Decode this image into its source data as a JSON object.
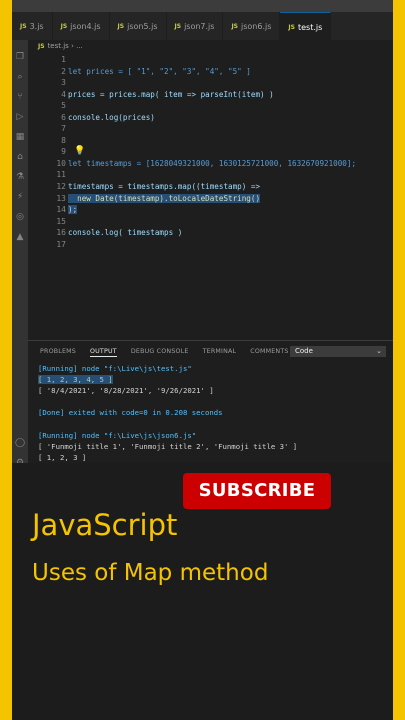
{
  "tabs": [
    {
      "name": "3.js",
      "active": false
    },
    {
      "name": "json4.js",
      "active": false
    },
    {
      "name": "json5.js",
      "active": false
    },
    {
      "name": "json7.js",
      "active": false
    },
    {
      "name": "json6.js",
      "active": false
    },
    {
      "name": "test.js",
      "active": true
    }
  ],
  "tab_icon": "JS",
  "breadcrumb": {
    "file": "test.js",
    "sep": "›",
    "more": "..."
  },
  "editor": {
    "line_numbers": [
      "1",
      "2",
      "3",
      "4",
      "5",
      "6",
      "7",
      "8",
      "9",
      "10",
      "11",
      "12",
      "13",
      "14",
      "15",
      "16",
      "17"
    ],
    "lines": {
      "l2": "let prices = [ \"1\", \"2\", \"3\", \"4\", \"5\" ]",
      "l4": "prices = prices.map( item => parseInt(item) )",
      "l6": "console.log(prices)",
      "l10": "let timestamps = [1628049321000, 1630125721000, 1632670921000];",
      "l12": "timestamps = timestamps.map((timestamp) =>",
      "l13": "  new Date(timestamp).toLocaleDateString()",
      "l14": ");",
      "l16": "console.log( timestamps )"
    }
  },
  "panel": {
    "tabs": [
      "PROBLEMS",
      "OUTPUT",
      "DEBUG CONSOLE",
      "TERMINAL",
      "COMMENTS"
    ],
    "active_tab": "OUTPUT",
    "dropdown_value": "Code",
    "output": {
      "o1": "[Running] node \"f:\\Live\\js\\test.js\"",
      "o2": "[ 1, 2, 3, 4, 5 ]",
      "o3": "[ '8/4/2021', '8/28/2021', '9/26/2021' ]",
      "o5": "[Done] exited with code=0 in 0.208 seconds",
      "o7": "[Running] node \"f:\\Live\\js\\json6.js\"",
      "o8": "[ 'Funmoji title 1', 'Funmoji title 2', 'Funmoji title 3' ]",
      "o9": "[ 1, 2, 3 ]"
    }
  },
  "overlay": {
    "subscribe": "SUBSCRIBE",
    "title": "JavaScript",
    "subtitle": "Uses of Map method"
  },
  "colors": {
    "background": "#f5c400",
    "subscribe": "#cc0000",
    "title": "#f5c400"
  }
}
